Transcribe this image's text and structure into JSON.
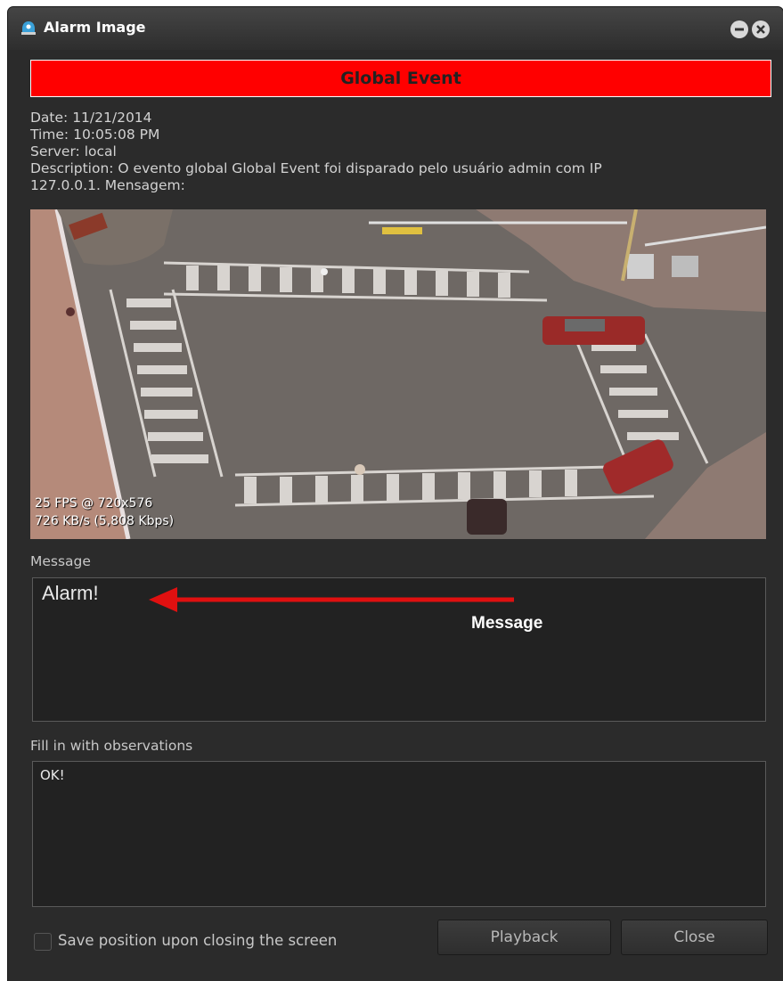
{
  "window": {
    "title": "Alarm Image",
    "icons": {
      "app": "alarm-app-icon",
      "minimize": "minimize-icon",
      "close": "close-icon"
    }
  },
  "banner": {
    "event_name": "Global Event",
    "color": "#ff0000"
  },
  "info": {
    "date": "Date: 11/21/2014",
    "time": "Time: 10:05:08 PM",
    "server": "Server: local",
    "description_line1": "Description: O evento global Global Event foi disparado pelo usuário admin com IP",
    "description_line2": "127.0.0.1. Mensagem:"
  },
  "video": {
    "fps": "25 FPS @ 720x576",
    "bitrate": "726 KB/s (5,808 Kbps)"
  },
  "message": {
    "label": "Message",
    "text": "Alarm!",
    "annotation": "Message"
  },
  "observations": {
    "label": "Fill in with observations",
    "text": "OK!"
  },
  "footer": {
    "save_position_label": "Save position upon closing the screen",
    "save_position_checked": false,
    "playback_label": "Playback",
    "close_label": "Close"
  }
}
